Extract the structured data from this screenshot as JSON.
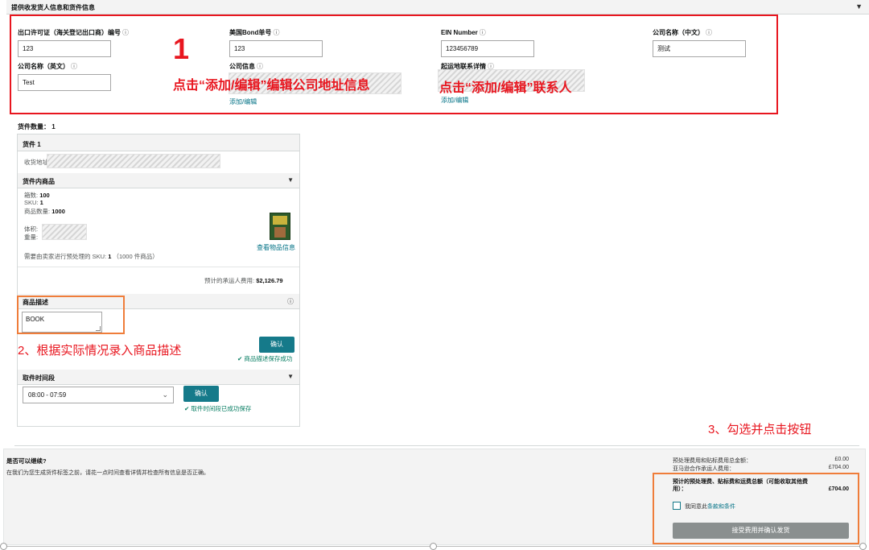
{
  "header": {
    "title": "提供收发货人信息和货件信息"
  },
  "address_form": {
    "export_license": {
      "label": "出口许可证（海关登记出口商）编号",
      "value": "123"
    },
    "bond_no": {
      "label": "美国Bond单号",
      "value": "123"
    },
    "ein": {
      "label": "EIN Number",
      "value": "123456789"
    },
    "company_cn": {
      "label": "公司名称（中文）",
      "value": "测试"
    },
    "company_en": {
      "label": "公司名称（英文）",
      "value": "Test"
    },
    "company_info": {
      "label": "公司信息",
      "link": "添加/编辑"
    },
    "contact": {
      "label": "起运地联系详情",
      "link": "添加/编辑"
    },
    "info_icon": "ⓘ"
  },
  "annotations": {
    "step1_number": "1",
    "step1_a": "点击“添加/编辑”编辑公司地址信息",
    "step1_b": "点击“添加/编辑”联系人",
    "step2": "2、根据实际情况录入商品描述",
    "step3": "3、勾选并点击按钮"
  },
  "shipment": {
    "count_label": "货件数量：",
    "count": "1",
    "title": "货件 1",
    "addr_label": "收货地址:",
    "items_title": "货件内商品",
    "boxes_label": "箱数:",
    "boxes": "100",
    "sku_label": "SKU:",
    "sku": "1",
    "qty_label": "商品数量:",
    "qty": "1000",
    "volume_label": "体积:",
    "weight_label": "重量:",
    "view_link": "查看物品信息",
    "prep_text": "需要由卖家进行预处理的 SKU:",
    "prep_count": "1",
    "prep_detail": "（1000 件商品）",
    "carrier_fee_label": "预计的承运人费用:",
    "carrier_fee": "$2,126.79",
    "desc_title": "商品描述",
    "desc_value": "BOOK",
    "confirm_label": "确认",
    "desc_saved": "商品描述保存成功",
    "pickup_title": "取件时间段",
    "pickup_value": "08:00 - 07:59",
    "pickup_saved": "取件时间段已成功保存"
  },
  "footer": {
    "title": "是否可以继续?",
    "note": "在我们为您生成货件标签之前，请花一点时间查看详情并检查所有信息是否正确。",
    "fee1_label": "预处理费用和贴标费用总金额：",
    "fee1_value": "£0.00",
    "fee2_label": "亚马逊合作承运人费用：",
    "fee2_value": "£704.00",
    "total_label": "预计的预处理费、贴标费和运费总额（可能收取其他费用）：",
    "total_value": "£704.00",
    "agree_text": "我同意此",
    "agree_link": "条款和条件",
    "accept_button": "接受费用并确认发货"
  },
  "icons": {
    "caret": "caret-down-icon",
    "check": "check-icon",
    "info": "info-icon",
    "book": "book-thumbnail"
  },
  "colors": {
    "teal": "#157a8a",
    "red": "#e8161f",
    "orange": "#ef7d3a",
    "success": "#067d62",
    "link": "#007185"
  }
}
